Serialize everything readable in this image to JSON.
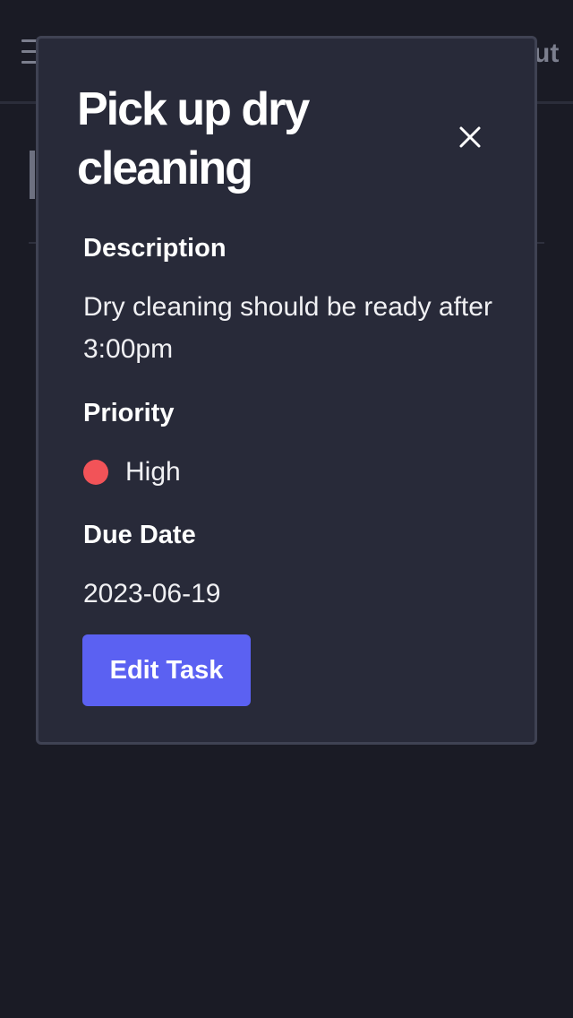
{
  "background": {
    "header_right_text": "ut"
  },
  "modal": {
    "title": "Pick up dry cleaning",
    "close_icon": "close-icon",
    "description_label": "Description",
    "description_value": "Dry cleaning should be ready after 3:00pm",
    "priority_label": "Priority",
    "priority_value": "High",
    "priority_color": "#f25358",
    "due_date_label": "Due Date",
    "due_date_value": "2023-06-19",
    "edit_button_label": "Edit Task",
    "accent_color": "#5b61f2"
  }
}
